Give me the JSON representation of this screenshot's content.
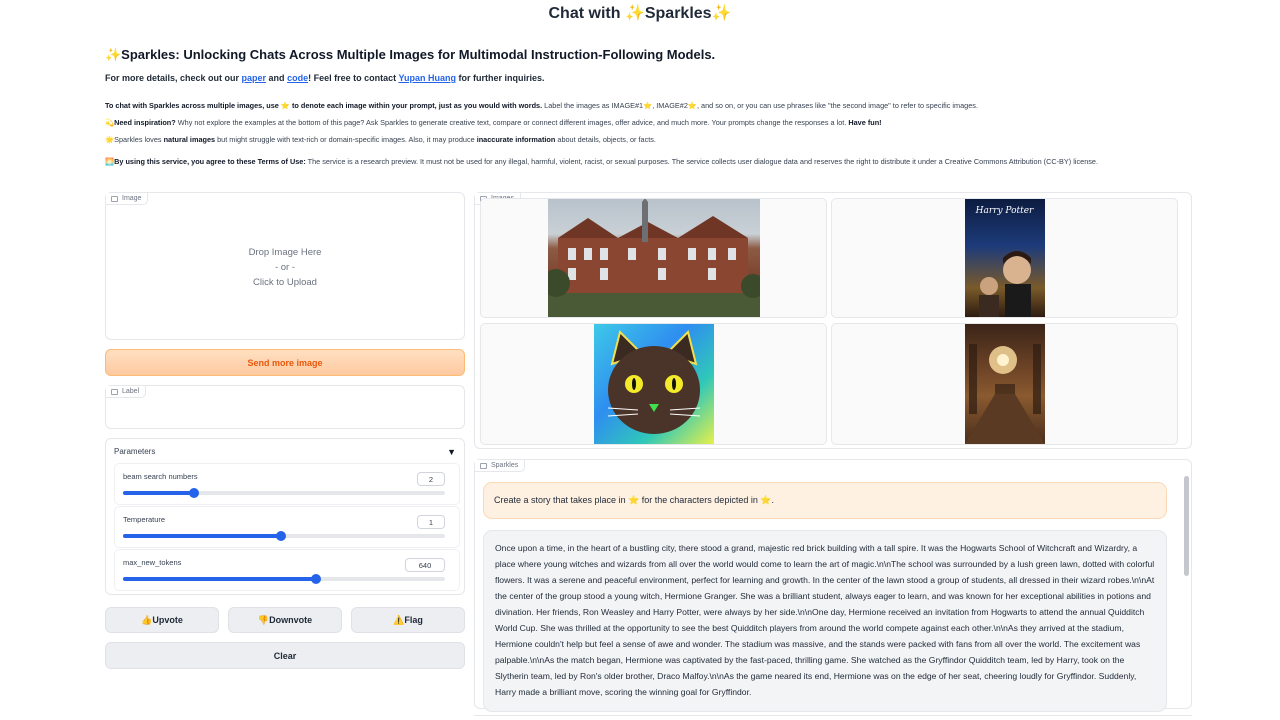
{
  "title": "Chat with ✨Sparkles✨",
  "intro": {
    "heading": "✨Sparkles: Unlocking Chats Across Multiple Images for Multimodal Instruction-Following Models.",
    "details_prefix": "For more details, check out our ",
    "paper_link": "paper",
    "and": " and ",
    "code_link": "code",
    "details_mid": "! Feel free to contact ",
    "author_link": "Yupan Huang",
    "details_suffix": " for further inquiries.",
    "line1_bold": "To chat with Sparkles across multiple images, use ⭐ to denote each image within your prompt, just as you would with words.",
    "line1_rest": " Label the images as IMAGE#1⭐, IMAGE#2⭐, and so on, or you can use phrases like \"the second image\" to refer to specific images.",
    "line2_icon": "💫",
    "line2_bold": "Need inspiration?",
    "line2_rest": " Why not explore the examples at the bottom of this page? Ask Sparkles to generate creative text, compare or connect different images, offer advice, and much more. Your prompts change the responses a lot. ",
    "line2_end": "Have fun!",
    "line3_a": "🌟Sparkles loves ",
    "line3_b": "natural images",
    "line3_c": " but might struggle with text-rich or domain-specific images. Also, it may produce ",
    "line3_d": "inaccurate information",
    "line3_e": " about details, objects, or facts.",
    "terms_bold": "🌅By using this service, you agree to these Terms of Use:",
    "terms_rest": " The service is a research preview. It must not be used for any illegal, harmful, violent, racist, or sexual purposes. The service collects user dialogue data and reserves the right to distribute it under a Creative Commons Attribution (CC-BY) license."
  },
  "upload": {
    "tag": "Image",
    "drop": "Drop Image Here",
    "or": "- or -",
    "click": "Click to Upload"
  },
  "send_button": "Send more image",
  "label_box": {
    "tag": "Label"
  },
  "parameters": {
    "header": "Parameters",
    "toggle": "▼",
    "items": [
      {
        "label": "beam search numbers",
        "value": "2",
        "fraction": 0.22
      },
      {
        "label": "Temperature",
        "value": "1",
        "fraction": 0.49
      },
      {
        "label": "max_new_tokens",
        "value": "640",
        "fraction": 0.6
      }
    ]
  },
  "buttons": {
    "upvote": "👍Upvote",
    "downvote": "👎Downvote",
    "flag": "⚠️Flag",
    "clear": "Clear"
  },
  "gallery": {
    "tag": "Images",
    "items": [
      "college-building-photo",
      "harry-potter-poster",
      "cat-painting",
      "great-hall-photo"
    ],
    "poster_title": "Harry Potter"
  },
  "chat": {
    "tag": "Sparkles",
    "user": "Create a story that takes place in ⭐ for the characters depicted in ⭐.",
    "bot": "Once upon a time, in the heart of a bustling city, there stood a grand, majestic red brick building with a tall spire. It was the Hogwarts School of Witchcraft and Wizardry, a place where young witches and wizards from all over the world would come to learn the art of magic.\\n\\nThe school was surrounded by a lush green lawn, dotted with colorful flowers. It was a serene and peaceful environment, perfect for learning and growth. In the center of the lawn stood a group of students, all dressed in their wizard robes.\\n\\nAt the center of the group stood a young witch, Hermione Granger. She was a brilliant student, always eager to learn, and was known for her exceptional abilities in potions and divination. Her friends, Ron Weasley and Harry Potter, were always by her side.\\n\\nOne day, Hermione received an invitation from Hogwarts to attend the annual Quidditch World Cup. She was thrilled at the opportunity to see the best Quidditch players from around the world compete against each other.\\n\\nAs they arrived at the stadium, Hermione couldn't help but feel a sense of awe and wonder. The stadium was massive, and the stands were packed with fans from all over the world. The excitement was palpable.\\n\\nAs the match began, Hermione was captivated by the fast-paced, thrilling game. She watched as the Gryffindor Quidditch team, led by Harry, took on the Slytherin team, led by Ron's older brother, Draco Malfoy.\\n\\nAs the game neared its end, Hermione was on the edge of her seat, cheering loudly for Gryffindor. Suddenly, Harry made a brilliant move, scoring the winning goal for Gryffindor."
  }
}
